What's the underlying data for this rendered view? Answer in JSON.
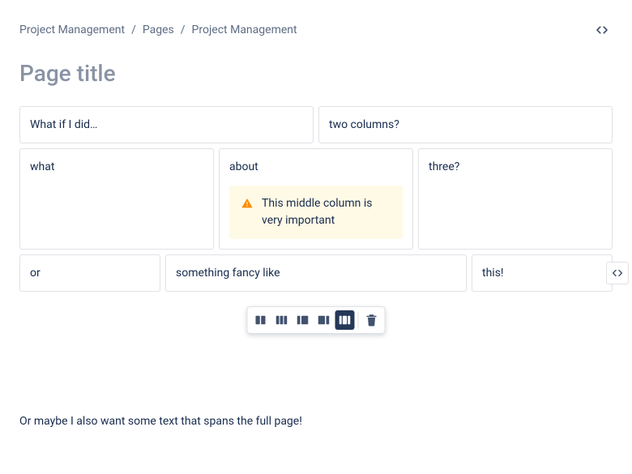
{
  "breadcrumb": {
    "items": [
      "Project Management",
      "Pages",
      "Project Management"
    ]
  },
  "title_placeholder": "Page title",
  "title_value": "",
  "rows": {
    "r1": {
      "c1": "What if I did…",
      "c2": "two columns?"
    },
    "r2": {
      "c1": "what",
      "c2": "about",
      "c3": "three?"
    },
    "r2_panel": "This middle column is very important",
    "r3": {
      "c1": "or",
      "c2": "something fancy like",
      "c3": "this!"
    }
  },
  "bottom_paragraph": "Or maybe I also want some text that spans the full page!",
  "toolbar": {
    "options": [
      "layout-two-equal",
      "layout-three-equal",
      "layout-left-sidebar",
      "layout-right-sidebar",
      "layout-three-with-sidebars"
    ],
    "selected": "layout-three-with-sidebars",
    "delete_label": "delete-layout"
  }
}
